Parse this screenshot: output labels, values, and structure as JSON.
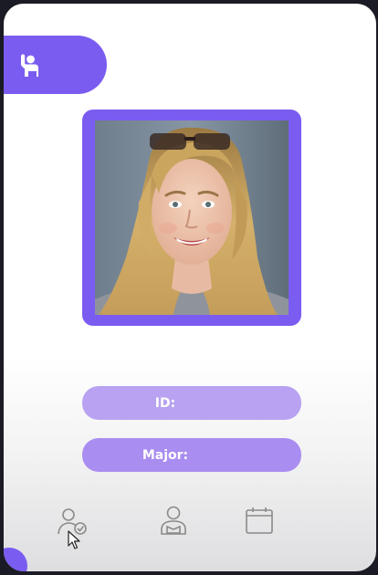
{
  "fields": {
    "id_label": "ID:",
    "id_value": "",
    "major_label": "Major:",
    "major_value": ""
  },
  "photo": {
    "description": "student-portrait"
  },
  "icons": {
    "header": "raised-hand-person-icon",
    "nav": [
      "attendance-check-icon",
      "student-profile-icon",
      "calendar-icon"
    ]
  },
  "colors": {
    "accent": "#7b5cf0",
    "field_fill": "#b59df0",
    "nav_stroke": "#8a8a8a"
  }
}
